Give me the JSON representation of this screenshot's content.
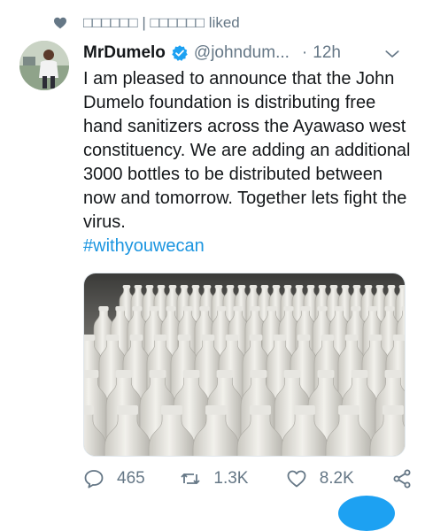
{
  "social_context": {
    "text": "□□□□□□ | □□□□□□ liked",
    "icon": "heart-icon"
  },
  "tweet": {
    "display_name": "MrDumelo",
    "handle": "@johndum...",
    "separator": "·",
    "time": "12h",
    "text": "I am pleased to announce that the John Dumelo foundation is distributing free hand sanitizers across the Ayawaso west constituency. We are adding an additional 3000 bottles to be distributed between now and tomorrow. Together lets fight the virus.",
    "hashtag": "#withyouwecan",
    "verified": true
  },
  "actions": {
    "reply_count": "465",
    "retweet_count": "1.3K",
    "like_count": "8.2K"
  },
  "colors": {
    "accent": "#1da1f2",
    "hashtag": "#1b95e0",
    "secondary_text": "#657786"
  }
}
